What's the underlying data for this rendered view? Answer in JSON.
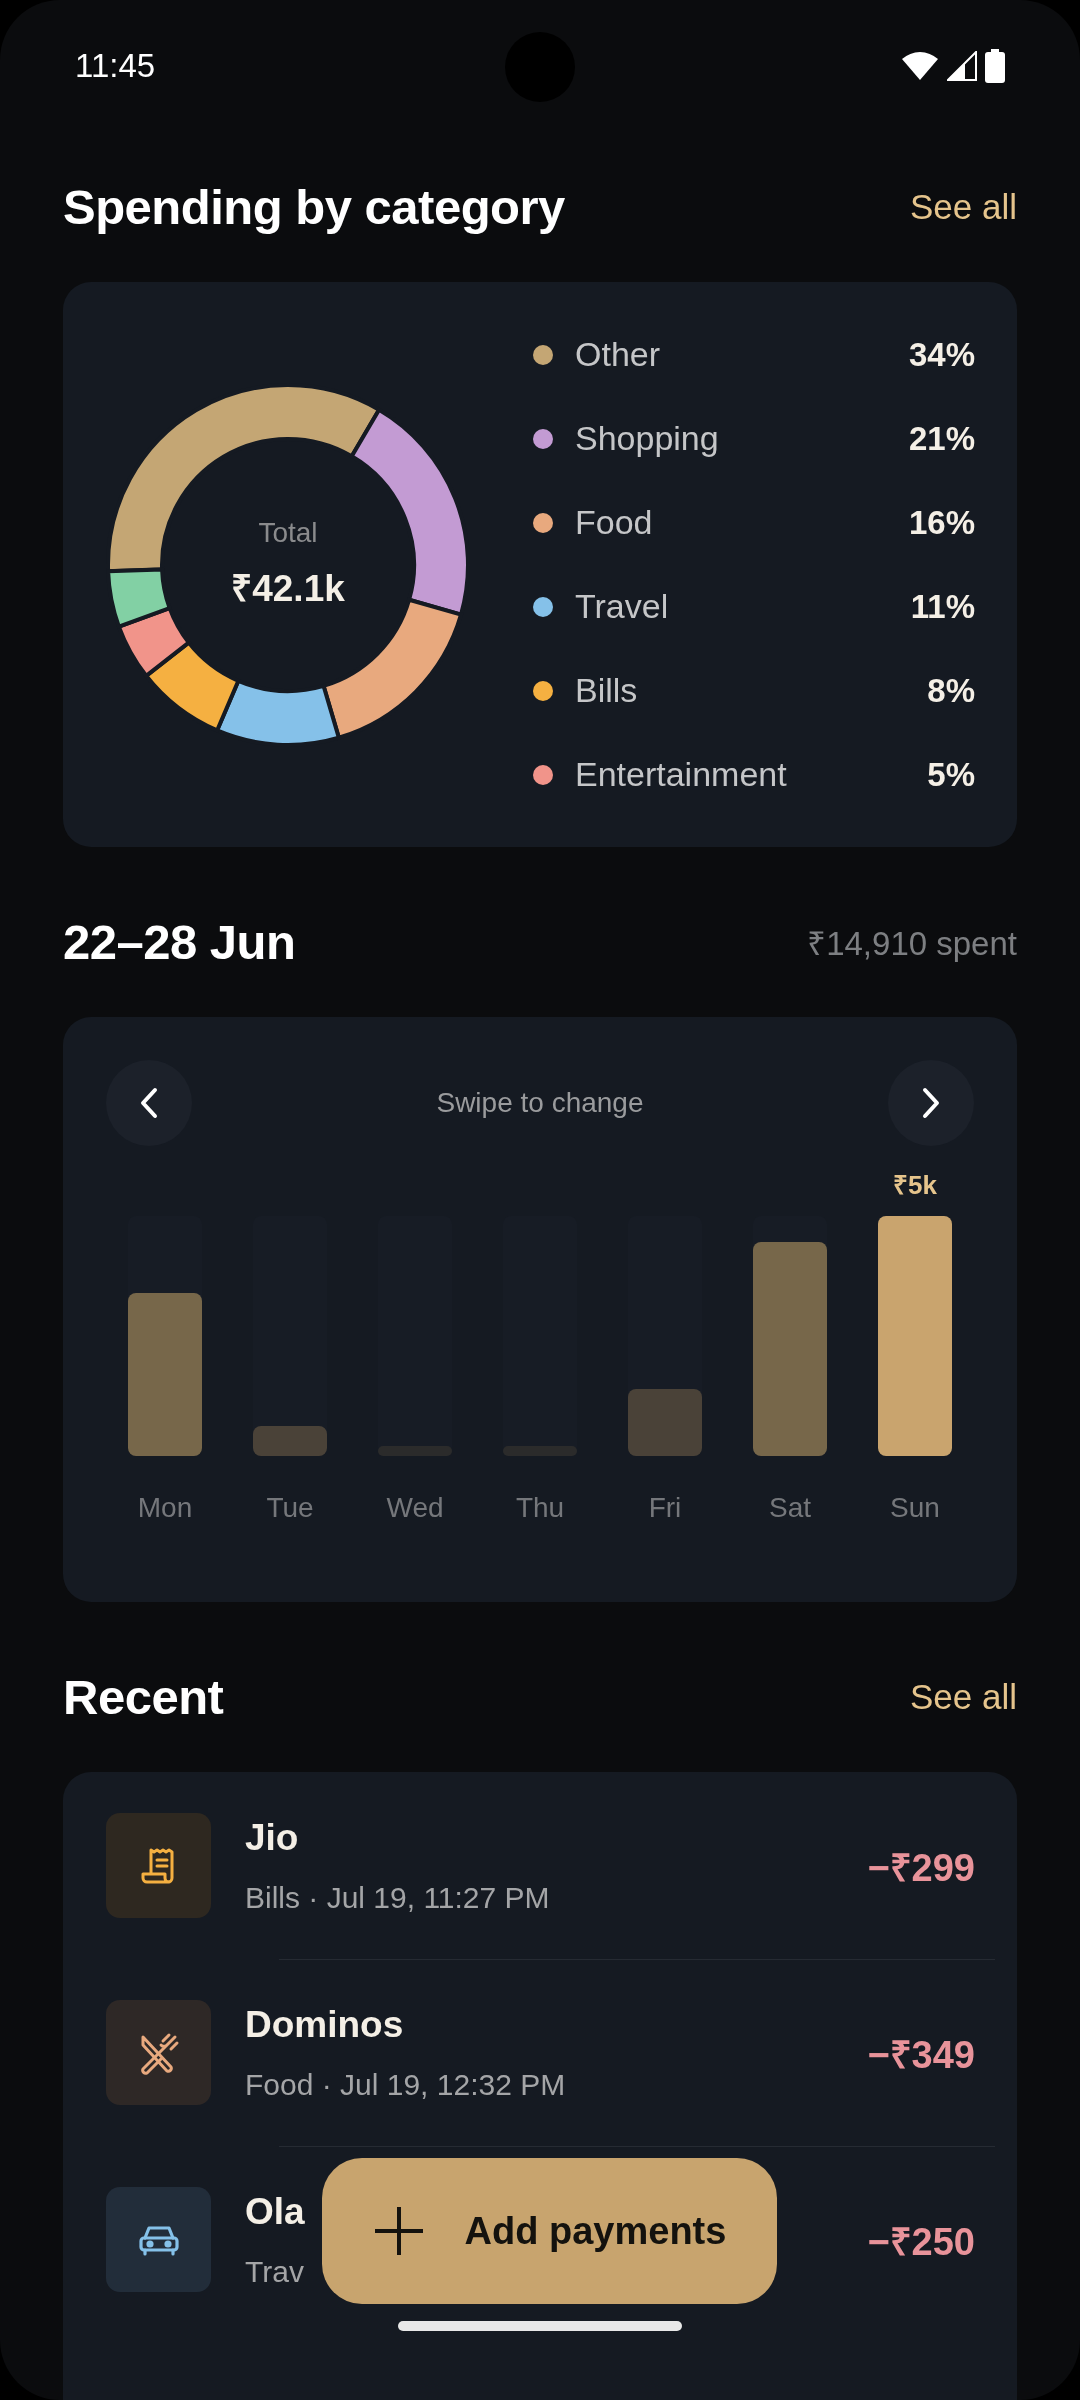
{
  "status_bar": {
    "time": "11:45"
  },
  "spending": {
    "title": "Spending by category",
    "see_all": "See all",
    "total_label": "Total",
    "total": "₹42.1k",
    "legend": [
      {
        "percent": "34%"
      },
      {
        "percent": "21%"
      },
      {
        "percent": "16%"
      },
      {
        "percent": "11%"
      },
      {
        "percent": "8%"
      },
      {
        "percent": "5%"
      }
    ],
    "chart_data": {
      "type": "donut",
      "categories": [
        "Other",
        "Shopping",
        "Food",
        "Travel",
        "Bills",
        "Entertainment",
        null
      ],
      "values": [
        34,
        21,
        16,
        11,
        8,
        5,
        5
      ],
      "colors": [
        "#c4a674",
        "#c39bd3",
        "#e8a97e",
        "#85c1e9",
        "#f5b041",
        "#f1948a",
        "#82d0a4"
      ]
    }
  },
  "week": {
    "title": "22–28 Jun",
    "spent": "₹14,910 spent",
    "hint": "Swipe to change",
    "days": [
      {
        "label": "Mon",
        "level": 0.68,
        "selected": false
      },
      {
        "label": "Tue",
        "level": 0.125,
        "selected": false
      },
      {
        "label": "Wed",
        "level": 0.04,
        "selected": false
      },
      {
        "label": "Thu",
        "level": 0.04,
        "selected": false
      },
      {
        "label": "Fri",
        "level": 0.28,
        "selected": false
      },
      {
        "label": "Sat",
        "level": 0.89,
        "selected": false
      },
      {
        "label": "Sun",
        "level": 1.0,
        "selected": true,
        "value_label": "₹5k"
      }
    ]
  },
  "recent": {
    "title": "Recent",
    "see_all": "See all",
    "items": [
      {
        "kind": "bills",
        "name": "Jio",
        "detail": "Bills · Jul 19, 11:27 PM",
        "amount": "−₹299"
      },
      {
        "kind": "food",
        "name": "Dominos",
        "detail": "Food · Jul 19, 12:32 PM",
        "amount": "−₹349"
      },
      {
        "kind": "travel",
        "name": "Ola",
        "detail": "Trav",
        "amount": "−₹250"
      }
    ]
  },
  "fab": {
    "label": "Add payments"
  }
}
